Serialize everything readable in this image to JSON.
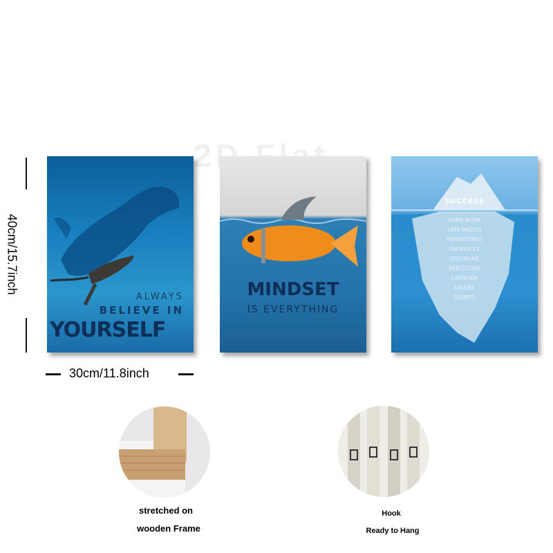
{
  "watermark": "2D Flat",
  "dimensions": {
    "height_label": "40cm/15.7inch",
    "width_label": "30cm/11.8inch"
  },
  "posters": [
    {
      "lines": [
        "ALWAYS",
        "BELIEVE IN",
        "YOURSELF"
      ]
    },
    {
      "lines": [
        "MINDSET",
        "IS EVERYTHING"
      ]
    },
    {
      "title": "SUCCESS",
      "words": [
        "HARD WORK",
        "LATE NIGHTS",
        "PERSISTENCE",
        "SACRIFICES",
        "DISCIPLINE",
        "REJECTIONS",
        "CRITICISM",
        "FAILURE",
        "DOUBTS"
      ]
    }
  ],
  "features": [
    {
      "caption_line1": "stretched on",
      "caption_line2": "wooden Frame"
    },
    {
      "caption_line1": "Hook",
      "caption_line2": "Ready to Hang"
    }
  ]
}
